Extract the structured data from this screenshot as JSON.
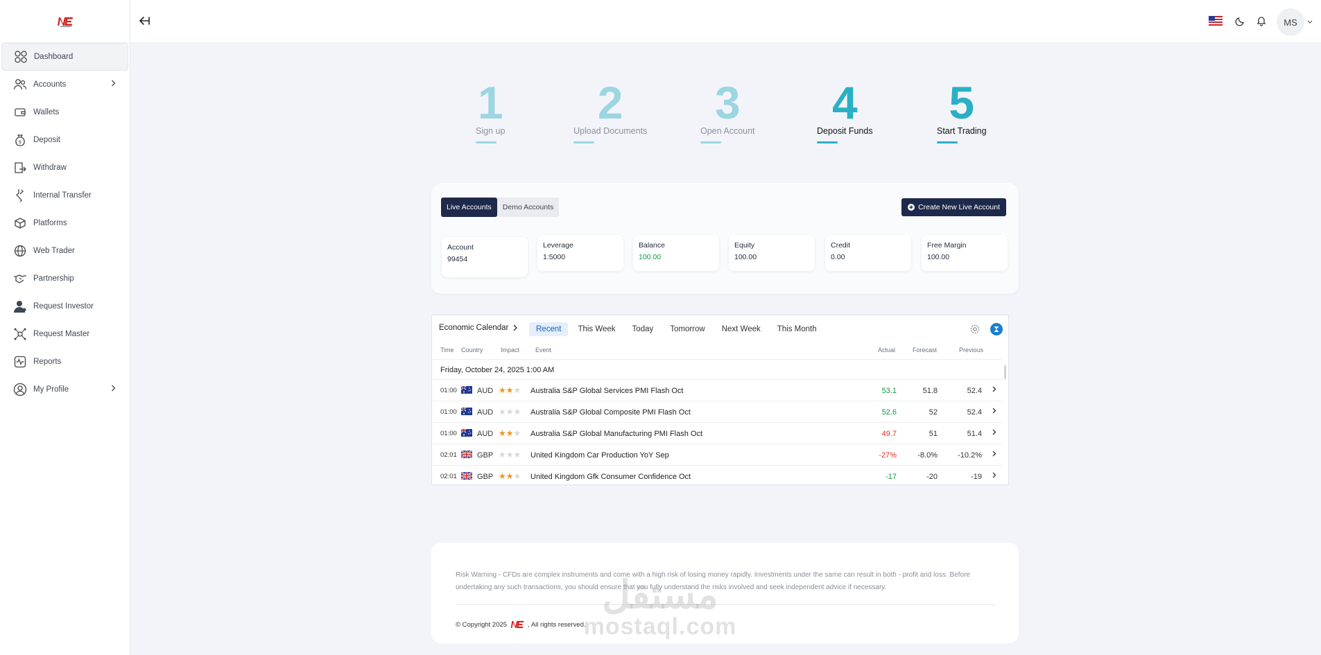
{
  "brand": {
    "logo_text": "NE"
  },
  "sidebar": {
    "items": [
      {
        "label": "Dashboard",
        "icon": "dashboard-grid-icon",
        "active": true
      },
      {
        "label": "Accounts",
        "icon": "users-icon",
        "has_children": true
      },
      {
        "label": "Wallets",
        "icon": "wallet-icon"
      },
      {
        "label": "Deposit",
        "icon": "money-bag-icon"
      },
      {
        "label": "Withdraw",
        "icon": "withdraw-icon"
      },
      {
        "label": "Internal Transfer",
        "icon": "transfer-icon"
      },
      {
        "label": "Platforms",
        "icon": "cube-icon"
      },
      {
        "label": "Web Trader",
        "icon": "globe-icon"
      },
      {
        "label": "Partnership",
        "icon": "handshake-icon"
      },
      {
        "label": "Request Investor",
        "icon": "user-icon"
      },
      {
        "label": "Request Master",
        "icon": "network-icon"
      },
      {
        "label": "Reports",
        "icon": "activity-icon"
      },
      {
        "label": "My Profile",
        "icon": "profile-icon",
        "has_children": true
      }
    ]
  },
  "topbar": {
    "user_initials": "MS",
    "language_flag": "us-flag-icon",
    "icons": [
      "back-arrow-icon",
      "moon-icon",
      "bell-icon",
      "chevron-down-icon"
    ]
  },
  "steps": [
    {
      "num": "1",
      "label": "Sign up",
      "done": false
    },
    {
      "num": "2",
      "label": "Upload Documents",
      "done": false
    },
    {
      "num": "3",
      "label": "Open Account",
      "done": false
    },
    {
      "num": "4",
      "label": "Deposit Funds",
      "done": true
    },
    {
      "num": "5",
      "label": "Start Trading",
      "done": true
    }
  ],
  "accounts": {
    "tabs": [
      "Live Accounts",
      "Demo Accounts"
    ],
    "active_tab": "Live Accounts",
    "create_label": "Create New Live Account",
    "stats": [
      {
        "key": "Account",
        "value": "99454"
      },
      {
        "key": "Leverage",
        "value": "1:5000"
      },
      {
        "key": "Balance",
        "value": "100.00",
        "color": "#0a9b3b"
      },
      {
        "key": "Equity",
        "value": "100.00"
      },
      {
        "key": "Credit",
        "value": "0.00"
      },
      {
        "key": "Free Margin",
        "value": "100.00"
      }
    ]
  },
  "calendar": {
    "title": "Economic Calendar",
    "tabs": [
      "Recent",
      "This Week",
      "Today",
      "Tomorrow",
      "Next Week",
      "This Month"
    ],
    "active_tab": "Recent",
    "columns": {
      "time": "Time",
      "country": "Country",
      "impact": "Impact",
      "event": "Event",
      "actual": "Actual",
      "forecast": "Forecast",
      "previous": "Previous"
    },
    "date_header": "Friday, October 24, 2025 1:00 AM",
    "rows": [
      {
        "time": "01:00",
        "currency": "AUD",
        "flag": "au",
        "impact": 2,
        "event": "Australia S&P Global Services PMI Flash Oct",
        "actual": "53.1",
        "actual_dir": "pos",
        "forecast": "51.8",
        "previous": "52.4"
      },
      {
        "time": "01:00",
        "currency": "AUD",
        "flag": "au",
        "impact": 0,
        "event": "Australia S&P Global Composite PMI Flash Oct",
        "actual": "52.6",
        "actual_dir": "pos",
        "forecast": "52",
        "previous": "52.4"
      },
      {
        "time": "01:00",
        "currency": "AUD",
        "flag": "au",
        "impact": 2,
        "event": "Australia S&P Global Manufacturing PMI Flash Oct",
        "actual": "49.7",
        "actual_dir": "neg",
        "forecast": "51",
        "previous": "51.4"
      },
      {
        "time": "02:01",
        "currency": "GBP",
        "flag": "gb",
        "impact": 0,
        "event": "United Kingdom Car Production YoY Sep",
        "actual": "-27%",
        "actual_dir": "neg",
        "forecast": "-8.0%",
        "previous": "-10.2%"
      },
      {
        "time": "02:01",
        "currency": "GBP",
        "flag": "gb",
        "impact": 2,
        "event": "United Kingdom Gfk Consumer Confidence Oct",
        "actual": "-17",
        "actual_dir": "pos",
        "forecast": "-20",
        "previous": "-19"
      }
    ]
  },
  "footer": {
    "warning": "Risk Warning - CFDs are complex instruments and come with a high risk of losing money rapidly. Investments under the same can result in both - profit and loss. Before undertaking any such transactions, you should ensure that you fully understand the risks involved and seek independent advice if necessary.",
    "copyright_prefix": "© Copyright 2025",
    "copyright_suffix": ", All rights reserved."
  },
  "watermark": {
    "arabic": "مستقل",
    "latin": "mostaql.com"
  },
  "colors": {
    "navy": "#1e2a4c",
    "teal": "#2ab0c6",
    "teal_light": "#9bd6e2",
    "positive": "#0a9b3b",
    "negative": "#e0311f",
    "star": "#f19320"
  }
}
